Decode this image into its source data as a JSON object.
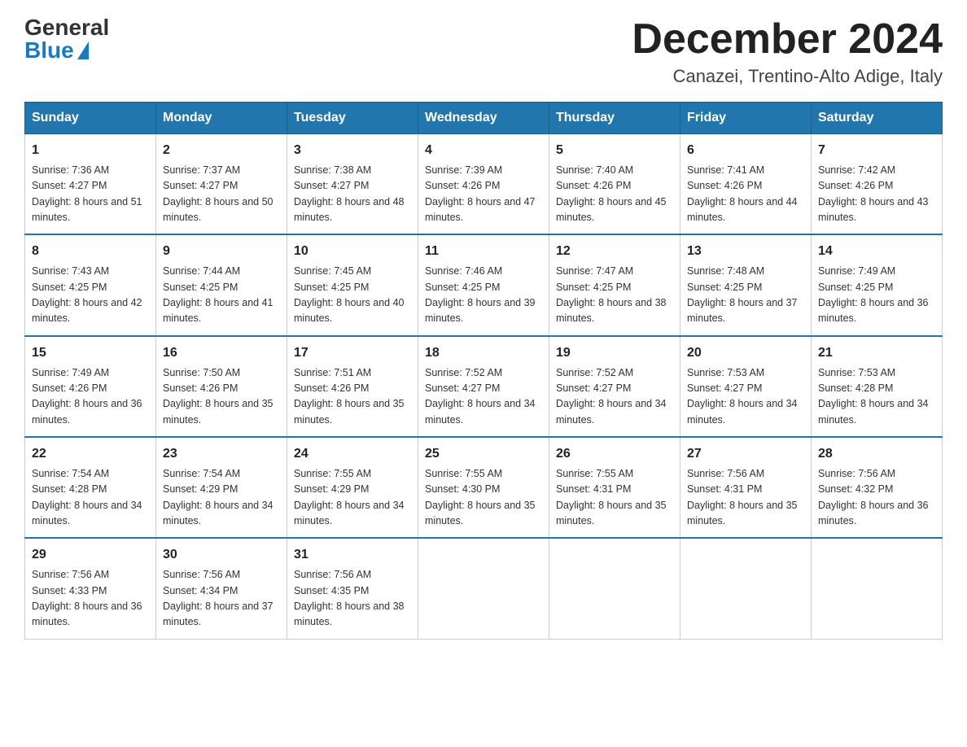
{
  "logo": {
    "general": "General",
    "blue": "Blue"
  },
  "title": "December 2024",
  "subtitle": "Canazei, Trentino-Alto Adige, Italy",
  "days_of_week": [
    "Sunday",
    "Monday",
    "Tuesday",
    "Wednesday",
    "Thursday",
    "Friday",
    "Saturday"
  ],
  "weeks": [
    [
      {
        "day": "1",
        "sunrise": "7:36 AM",
        "sunset": "4:27 PM",
        "daylight": "8 hours and 51 minutes."
      },
      {
        "day": "2",
        "sunrise": "7:37 AM",
        "sunset": "4:27 PM",
        "daylight": "8 hours and 50 minutes."
      },
      {
        "day": "3",
        "sunrise": "7:38 AM",
        "sunset": "4:27 PM",
        "daylight": "8 hours and 48 minutes."
      },
      {
        "day": "4",
        "sunrise": "7:39 AM",
        "sunset": "4:26 PM",
        "daylight": "8 hours and 47 minutes."
      },
      {
        "day": "5",
        "sunrise": "7:40 AM",
        "sunset": "4:26 PM",
        "daylight": "8 hours and 45 minutes."
      },
      {
        "day": "6",
        "sunrise": "7:41 AM",
        "sunset": "4:26 PM",
        "daylight": "8 hours and 44 minutes."
      },
      {
        "day": "7",
        "sunrise": "7:42 AM",
        "sunset": "4:26 PM",
        "daylight": "8 hours and 43 minutes."
      }
    ],
    [
      {
        "day": "8",
        "sunrise": "7:43 AM",
        "sunset": "4:25 PM",
        "daylight": "8 hours and 42 minutes."
      },
      {
        "day": "9",
        "sunrise": "7:44 AM",
        "sunset": "4:25 PM",
        "daylight": "8 hours and 41 minutes."
      },
      {
        "day": "10",
        "sunrise": "7:45 AM",
        "sunset": "4:25 PM",
        "daylight": "8 hours and 40 minutes."
      },
      {
        "day": "11",
        "sunrise": "7:46 AM",
        "sunset": "4:25 PM",
        "daylight": "8 hours and 39 minutes."
      },
      {
        "day": "12",
        "sunrise": "7:47 AM",
        "sunset": "4:25 PM",
        "daylight": "8 hours and 38 minutes."
      },
      {
        "day": "13",
        "sunrise": "7:48 AM",
        "sunset": "4:25 PM",
        "daylight": "8 hours and 37 minutes."
      },
      {
        "day": "14",
        "sunrise": "7:49 AM",
        "sunset": "4:25 PM",
        "daylight": "8 hours and 36 minutes."
      }
    ],
    [
      {
        "day": "15",
        "sunrise": "7:49 AM",
        "sunset": "4:26 PM",
        "daylight": "8 hours and 36 minutes."
      },
      {
        "day": "16",
        "sunrise": "7:50 AM",
        "sunset": "4:26 PM",
        "daylight": "8 hours and 35 minutes."
      },
      {
        "day": "17",
        "sunrise": "7:51 AM",
        "sunset": "4:26 PM",
        "daylight": "8 hours and 35 minutes."
      },
      {
        "day": "18",
        "sunrise": "7:52 AM",
        "sunset": "4:27 PM",
        "daylight": "8 hours and 34 minutes."
      },
      {
        "day": "19",
        "sunrise": "7:52 AM",
        "sunset": "4:27 PM",
        "daylight": "8 hours and 34 minutes."
      },
      {
        "day": "20",
        "sunrise": "7:53 AM",
        "sunset": "4:27 PM",
        "daylight": "8 hours and 34 minutes."
      },
      {
        "day": "21",
        "sunrise": "7:53 AM",
        "sunset": "4:28 PM",
        "daylight": "8 hours and 34 minutes."
      }
    ],
    [
      {
        "day": "22",
        "sunrise": "7:54 AM",
        "sunset": "4:28 PM",
        "daylight": "8 hours and 34 minutes."
      },
      {
        "day": "23",
        "sunrise": "7:54 AM",
        "sunset": "4:29 PM",
        "daylight": "8 hours and 34 minutes."
      },
      {
        "day": "24",
        "sunrise": "7:55 AM",
        "sunset": "4:29 PM",
        "daylight": "8 hours and 34 minutes."
      },
      {
        "day": "25",
        "sunrise": "7:55 AM",
        "sunset": "4:30 PM",
        "daylight": "8 hours and 35 minutes."
      },
      {
        "day": "26",
        "sunrise": "7:55 AM",
        "sunset": "4:31 PM",
        "daylight": "8 hours and 35 minutes."
      },
      {
        "day": "27",
        "sunrise": "7:56 AM",
        "sunset": "4:31 PM",
        "daylight": "8 hours and 35 minutes."
      },
      {
        "day": "28",
        "sunrise": "7:56 AM",
        "sunset": "4:32 PM",
        "daylight": "8 hours and 36 minutes."
      }
    ],
    [
      {
        "day": "29",
        "sunrise": "7:56 AM",
        "sunset": "4:33 PM",
        "daylight": "8 hours and 36 minutes."
      },
      {
        "day": "30",
        "sunrise": "7:56 AM",
        "sunset": "4:34 PM",
        "daylight": "8 hours and 37 minutes."
      },
      {
        "day": "31",
        "sunrise": "7:56 AM",
        "sunset": "4:35 PM",
        "daylight": "8 hours and 38 minutes."
      },
      null,
      null,
      null,
      null
    ]
  ],
  "labels": {
    "sunrise": "Sunrise:",
    "sunset": "Sunset:",
    "daylight": "Daylight:"
  }
}
